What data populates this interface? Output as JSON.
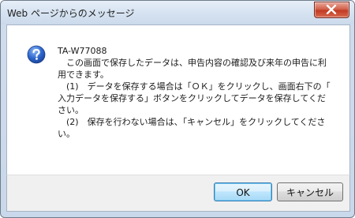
{
  "window": {
    "title": "Web ページからのメッセージ"
  },
  "message": {
    "code": "TA-W77088",
    "lines": [
      "　この画面で保存したデータは、申告内容の確認及び来年の申告に利",
      "用できます。",
      "　(1)　データを保存する場合は「ＯＫ」をクリックし、画面右下の「",
      "入力データを保存する」ボタンをクリックしてデータを保存してくだ",
      "さい。",
      "　(2)　保存を行わない場合は、「キャンセル」をクリックしてくださ",
      "い。"
    ]
  },
  "buttons": {
    "ok_label": "OK",
    "cancel_label": "キャンセル"
  },
  "colors": {
    "titlebar": "#d4e1f0",
    "close_button": "#c23a22",
    "icon_blue": "#2a5fc0",
    "ok_focus": "#3c7fb1"
  },
  "icons": {
    "info": "question-icon",
    "close": "close-icon"
  }
}
